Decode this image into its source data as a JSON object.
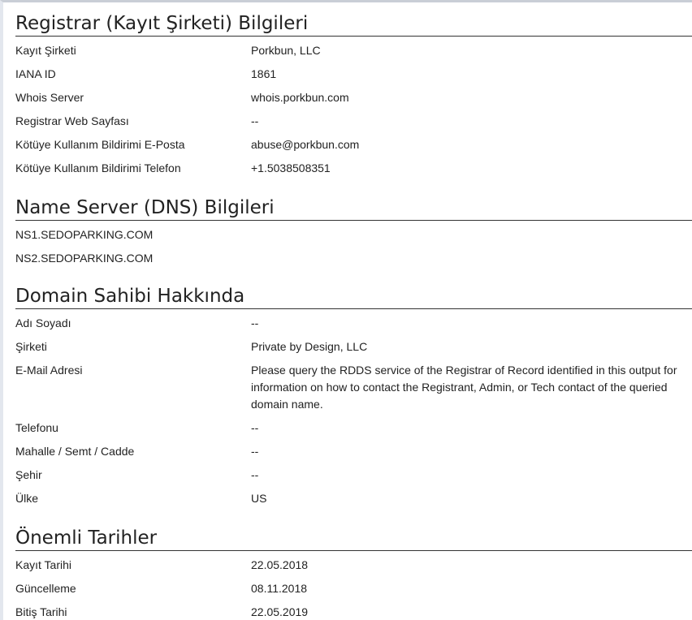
{
  "registrar": {
    "title": "Registrar (Kayıt Şirketi) Bilgileri",
    "rows": [
      {
        "label": "Kayıt Şirketi",
        "value": "Porkbun, LLC"
      },
      {
        "label": "IANA ID",
        "value": "1861"
      },
      {
        "label": "Whois Server",
        "value": "whois.porkbun.com"
      },
      {
        "label": "Registrar Web Sayfası",
        "value": "--"
      },
      {
        "label": "Kötüye Kullanım Bildirimi E-Posta",
        "value": "abuse@porkbun.com"
      },
      {
        "label": "Kötüye Kullanım Bildirimi Telefon",
        "value": "+1.5038508351"
      }
    ]
  },
  "nameservers": {
    "title": "Name Server (DNS) Bilgileri",
    "items": [
      "NS1.SEDOPARKING.COM",
      "NS2.SEDOPARKING.COM"
    ]
  },
  "owner": {
    "title": "Domain Sahibi Hakkında",
    "rows": [
      {
        "label": "Adı Soyadı",
        "value": "--"
      },
      {
        "label": "Şirketi",
        "value": "Private by Design, LLC"
      },
      {
        "label": "E-Mail Adresi",
        "value": "Please query the RDDS service of the Registrar of Record identified in this output for information on how to contact the Registrant, Admin, or Tech contact of the queried domain name."
      },
      {
        "label": "Telefonu",
        "value": "--"
      },
      {
        "label": "Mahalle / Semt / Cadde",
        "value": "--"
      },
      {
        "label": "Şehir",
        "value": "--"
      },
      {
        "label": "Ülke",
        "value": "US"
      }
    ]
  },
  "dates": {
    "title": "Önemli Tarihler",
    "rows": [
      {
        "label": "Kayıt Tarihi",
        "value": "22.05.2018"
      },
      {
        "label": "Güncelleme",
        "value": "08.11.2018"
      },
      {
        "label": "Bitiş Tarihi",
        "value": "22.05.2019"
      }
    ]
  }
}
